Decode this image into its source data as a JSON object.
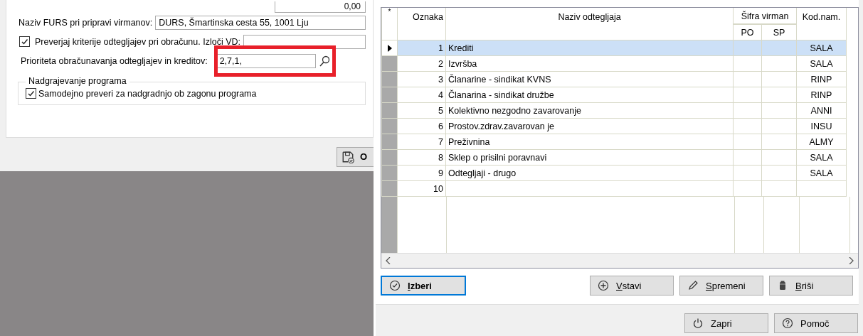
{
  "settings": {
    "top_field_value": "0,00",
    "fields": [
      {
        "kind": "text",
        "label": "Naziv FURS pri pripravi virmanov:",
        "value": "DURS, Šmartinska cesta 55, 1001 Lju"
      },
      {
        "kind": "checkfield",
        "label": "Preverjaj kriterije odtegljajev pri obračunu. Izloči VD:",
        "checked": true
      },
      {
        "kind": "search",
        "label": "Prioriteta obračunavanja odtegljajev in kreditov:",
        "value": "2,7,1,",
        "highlighted": true
      }
    ],
    "group": {
      "title": "Nadgrajevanje programa",
      "checkbox": {
        "label": "Samodejno preveri za nadgradnjo ob zagonu programa",
        "checked": true
      }
    },
    "save_button": {
      "label": "O"
    }
  },
  "grid": {
    "columns": {
      "marker": "*",
      "code": "Oznaka",
      "name": "Naziv odtegljaja",
      "group": "Šifra virman",
      "po": "PO",
      "sp": "SP",
      "kod": "Kod.nam."
    },
    "rows": [
      {
        "code": "1",
        "name": "Krediti",
        "kod": "SALA",
        "selected": true
      },
      {
        "code": "2",
        "name": "Izvršba",
        "kod": "SALA",
        "selected": false
      },
      {
        "code": "3",
        "name": "Članarine - sindikat KVNS",
        "kod": "RINP",
        "selected": false
      },
      {
        "code": "4",
        "name": "Članarina - sindikat družbe",
        "kod": "RINP",
        "selected": false
      },
      {
        "code": "5",
        "name": "Kolektivno nezgodno zavarovanje",
        "kod": "ANNI",
        "selected": false
      },
      {
        "code": "6",
        "name": "Prostov.zdrav.zavarovan je",
        "kod": "INSU",
        "selected": false
      },
      {
        "code": "7",
        "name": "Preživnina",
        "kod": "ALMY",
        "selected": false
      },
      {
        "code": "8",
        "name": "Sklep o prisilni poravnavi",
        "kod": "SALA",
        "selected": false
      },
      {
        "code": "9",
        "name": "Odtegljaji - drugo",
        "kod": "SALA",
        "selected": false
      },
      {
        "code": "10",
        "selected": false
      }
    ]
  },
  "actions": [
    {
      "kind": "select",
      "label": "Izberi",
      "default": true,
      "access_key": true
    },
    {
      "kind": "insert",
      "label": "Vstavi",
      "default": false,
      "access_key": true
    },
    {
      "kind": "edit",
      "label": "Spremeni",
      "default": false,
      "access_key": true
    },
    {
      "kind": "delete",
      "label": "Briši",
      "default": false,
      "access_key": true
    }
  ],
  "footer": [
    {
      "kind": "close",
      "label": "Zapri",
      "access_key": false
    },
    {
      "kind": "help",
      "label": "Pomoč",
      "access_key": false
    }
  ]
}
